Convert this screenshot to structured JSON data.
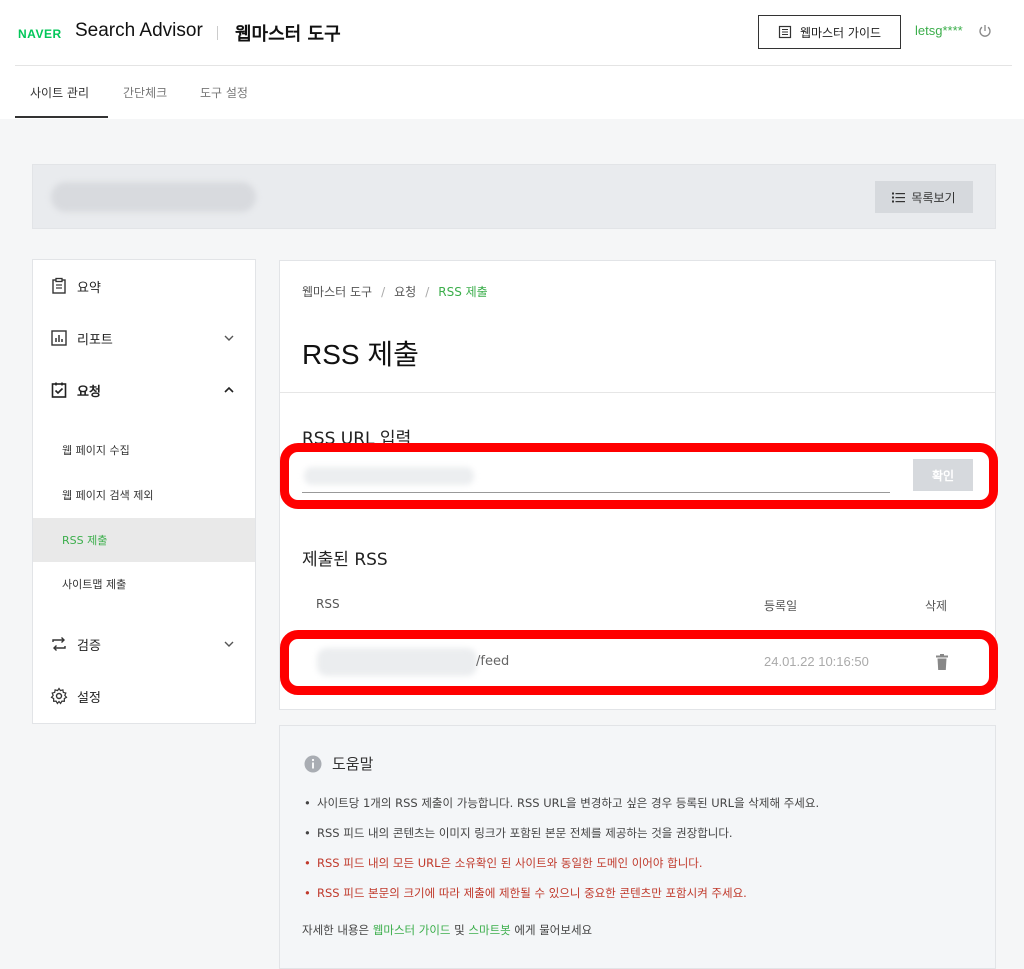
{
  "header": {
    "brand": "NAVER",
    "product": "Search Advisor",
    "title": "웹마스터 도구",
    "guide_button": "웹마스터 가이드",
    "user": "letsg****"
  },
  "tabs": [
    {
      "label": "사이트 관리",
      "active": true
    },
    {
      "label": "간단체크",
      "active": false
    },
    {
      "label": "도구 설정",
      "active": false
    }
  ],
  "sitebar": {
    "list_button": "목록보기"
  },
  "sidebar": {
    "items": [
      {
        "label": "요약",
        "icon": "clipboard-icon"
      },
      {
        "label": "리포트",
        "icon": "report-icon",
        "chevron": "down"
      },
      {
        "label": "요청",
        "icon": "request-icon",
        "chevron": "up"
      },
      {
        "label": "검증",
        "icon": "verify-icon",
        "chevron": "down"
      },
      {
        "label": "설정",
        "icon": "gear-icon"
      }
    ],
    "sub_items": [
      {
        "label": "웹 페이지 수집",
        "active": false
      },
      {
        "label": "웹 페이지 검색 제외",
        "active": false
      },
      {
        "label": "RSS 제출",
        "active": true
      },
      {
        "label": "사이트맵 제출",
        "active": false
      }
    ]
  },
  "main": {
    "breadcrumb": [
      "웹마스터 도구",
      "요청",
      "RSS 제출"
    ],
    "title": "RSS 제출",
    "input_section": "RSS URL 입력",
    "input_value": "",
    "confirm_button": "확인",
    "submitted_section": "제출된 RSS",
    "table": {
      "headers": [
        "RSS",
        "등록일",
        "삭제"
      ],
      "rows": [
        {
          "rss_suffix": "/feed",
          "date": "24.01.22 10:16:50"
        }
      ]
    }
  },
  "help": {
    "title": "도움말",
    "items": [
      {
        "text": "사이트당 1개의 RSS 제출이 가능합니다. RSS URL을 변경하고 싶은 경우 등록된 URL을 삭제해 주세요.",
        "warn": false
      },
      {
        "text": "RSS 피드 내의 콘텐츠는 이미지 링크가 포함된 본문 전체를 제공하는 것을 권장합니다.",
        "warn": false
      },
      {
        "text": "RSS 피드 내의 모든 URL은 소유확인 된 사이트와 동일한 도메인 이어야 합니다.",
        "warn": true
      },
      {
        "text": "RSS 피드 본문의 크기에 따라 제출에 제한될 수 있으니 중요한 콘텐츠만 포함시켜 주세요.",
        "warn": true
      }
    ],
    "footer_prefix": "자세한 내용은",
    "footer_link1": "웹마스터 가이드",
    "footer_and": "및",
    "footer_link2": "스마트봇",
    "footer_suffix": "에게 물어보세요"
  },
  "colors": {
    "accent": "#3bae4b",
    "highlight": "#ff0000",
    "warning": "#c0392b"
  }
}
